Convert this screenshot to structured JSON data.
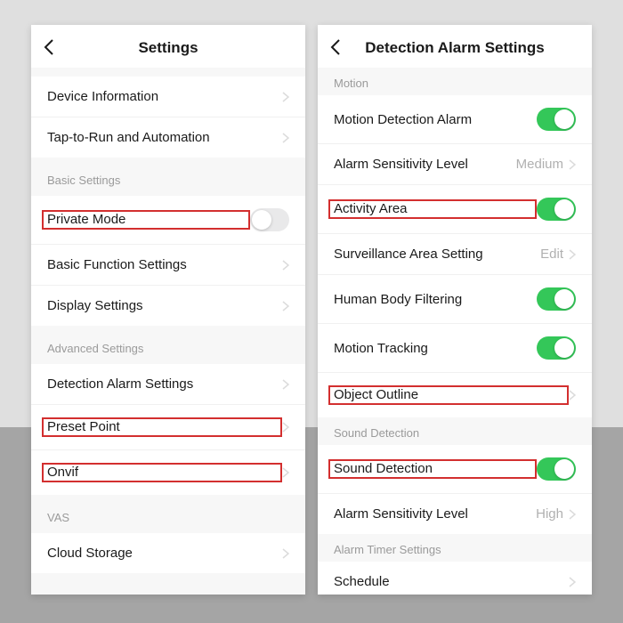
{
  "left": {
    "title": "Settings",
    "groups": [
      {
        "header": null,
        "tight": false,
        "rows": [
          {
            "label": "Device Information",
            "type": "nav",
            "hl": false
          },
          {
            "label": "Tap-to-Run and Automation",
            "type": "nav",
            "hl": false
          }
        ]
      },
      {
        "header": "Basic Settings",
        "tight": false,
        "rows": [
          {
            "label": "Private Mode",
            "type": "toggle",
            "on": false,
            "hl": true
          },
          {
            "label": "Basic Function Settings",
            "type": "nav",
            "hl": false
          },
          {
            "label": "Display Settings",
            "type": "nav",
            "hl": false
          }
        ]
      },
      {
        "header": "Advanced Settings",
        "tight": false,
        "rows": [
          {
            "label": "Detection Alarm Settings",
            "type": "nav",
            "hl": false
          },
          {
            "label": "Preset Point",
            "type": "nav",
            "hl": true
          },
          {
            "label": "Onvif",
            "type": "nav",
            "hl": true
          }
        ]
      },
      {
        "header": "VAS",
        "tight": false,
        "rows": [
          {
            "label": "Cloud Storage",
            "type": "nav",
            "hl": false
          }
        ]
      }
    ]
  },
  "right": {
    "title": "Detection Alarm Settings",
    "groups": [
      {
        "header": "Motion",
        "tight": true,
        "rows": [
          {
            "label": "Motion Detection Alarm",
            "type": "toggle",
            "on": true,
            "hl": false
          },
          {
            "label": "Alarm Sensitivity Level",
            "type": "value",
            "value": "Medium",
            "hl": false
          },
          {
            "label": "Activity Area",
            "type": "toggle",
            "on": true,
            "hl": true
          },
          {
            "label": "Surveillance Area Setting",
            "type": "value",
            "value": "Edit",
            "hl": false
          },
          {
            "label": "Human Body Filtering",
            "type": "toggle",
            "on": true,
            "hl": false
          },
          {
            "label": "Motion Tracking",
            "type": "toggle",
            "on": true,
            "hl": false
          },
          {
            "label": "Object Outline",
            "type": "nav",
            "hl": true
          }
        ]
      },
      {
        "header": "Sound Detection",
        "tight": true,
        "rows": [
          {
            "label": "Sound Detection",
            "type": "toggle",
            "on": true,
            "hl": true
          },
          {
            "label": "Alarm Sensitivity Level",
            "type": "value",
            "value": "High",
            "hl": false
          }
        ]
      },
      {
        "header": "Alarm Timer Settings",
        "tight": true,
        "rows": [
          {
            "label": "Schedule",
            "type": "nav",
            "hl": false
          }
        ]
      }
    ]
  }
}
